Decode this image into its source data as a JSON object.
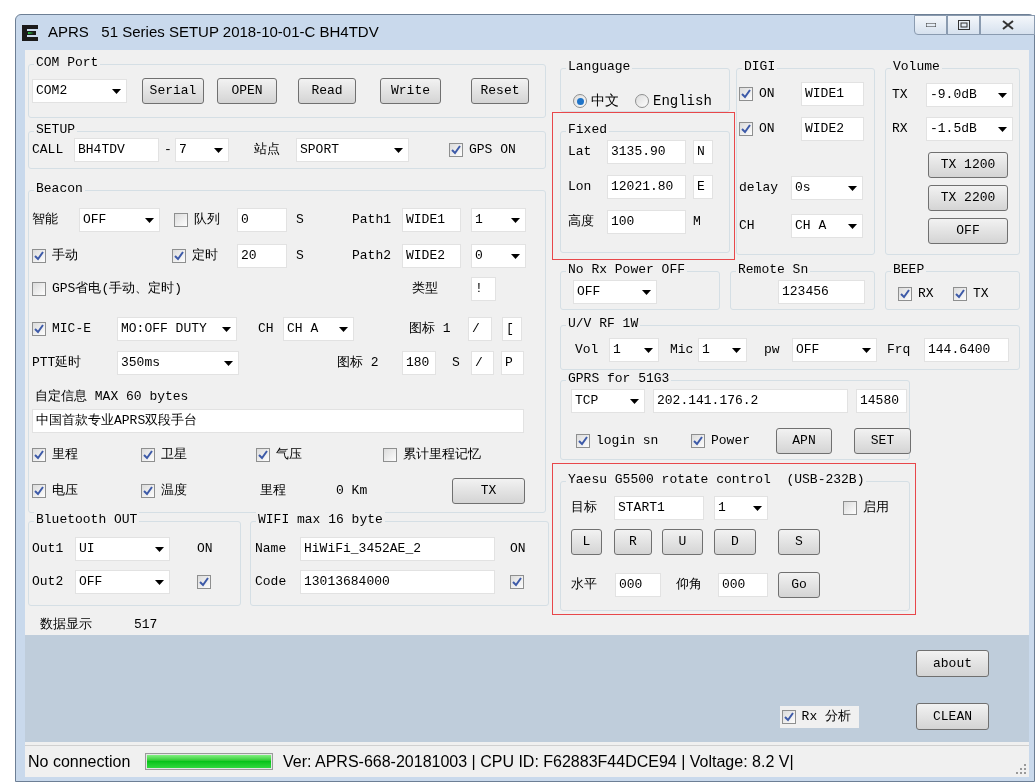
{
  "window": {
    "title": "APRS   51 Series SETUP 2018-10-01-C BH4TDV"
  },
  "left_groups": [
    {
      "title": "COM Port",
      "highlighted": false,
      "rows": [
        {
          "items": [
            {
              "kind": "combo",
              "value": "COM2"
            },
            {
              "kind": "button",
              "label": "Serial"
            },
            {
              "kind": "button",
              "label": "OPEN"
            },
            {
              "kind": "button",
              "label": "Read"
            },
            {
              "kind": "button",
              "label": "Write"
            },
            {
              "kind": "button",
              "label": "Reset"
            }
          ]
        }
      ]
    },
    {
      "title": "SETUP",
      "highlighted": false,
      "rows": [
        {
          "items": [
            {
              "kind": "label",
              "text": "CALL"
            },
            {
              "kind": "text",
              "value": "BH4TDV"
            },
            {
              "kind": "label",
              "text": "-"
            },
            {
              "kind": "combo",
              "value": "7"
            },
            {
              "kind": "label",
              "text": "站点"
            },
            {
              "kind": "combo",
              "value": "SPORT"
            },
            {
              "kind": "check",
              "label": "GPS ON",
              "checked": true
            }
          ]
        }
      ]
    },
    {
      "title": "Beacon",
      "highlighted": false,
      "rows": [
        {
          "items": [
            {
              "kind": "label",
              "text": "智能"
            },
            {
              "kind": "combo",
              "value": "OFF"
            },
            {
              "kind": "check",
              "label": "队列",
              "checked": false
            },
            {
              "kind": "text",
              "value": "0"
            },
            {
              "kind": "label",
              "text": "S"
            },
            {
              "kind": "label",
              "text": "Path1"
            },
            {
              "kind": "text",
              "value": "WIDE1"
            },
            {
              "kind": "combo",
              "value": "1"
            }
          ]
        },
        {
          "items": [
            {
              "kind": "check",
              "label": "手动",
              "checked": true
            },
            {
              "kind": "check",
              "label": "定时",
              "checked": true
            },
            {
              "kind": "text",
              "value": "20"
            },
            {
              "kind": "label",
              "text": "S"
            },
            {
              "kind": "label",
              "text": "Path2"
            },
            {
              "kind": "text",
              "value": "WIDE2"
            },
            {
              "kind": "combo",
              "value": "0"
            }
          ]
        },
        {
          "items": [
            {
              "kind": "check",
              "label": "GPS省电(手动、定时)",
              "checked": false
            },
            {
              "kind": "label",
              "text": "类型"
            },
            {
              "kind": "text",
              "value": "!"
            }
          ]
        },
        {
          "items": [
            {
              "kind": "check",
              "label": "MIC-E",
              "checked": true
            },
            {
              "kind": "combo",
              "value": "MO:OFF DUTY"
            },
            {
              "kind": "label",
              "text": "CH"
            },
            {
              "kind": "combo",
              "value": "CH A"
            },
            {
              "kind": "label",
              "text": "图标 1"
            },
            {
              "kind": "text",
              "value": "/"
            },
            {
              "kind": "text",
              "value": "["
            }
          ]
        },
        {
          "items": [
            {
              "kind": "label",
              "text": "PTT延时"
            },
            {
              "kind": "combo",
              "value": "350ms"
            },
            {
              "kind": "label",
              "text": "图标 2"
            },
            {
              "kind": "text",
              "value": "180"
            },
            {
              "kind": "label",
              "text": "S"
            },
            {
              "kind": "text",
              "value": "/"
            },
            {
              "kind": "text",
              "value": "P"
            }
          ]
        },
        {
          "items": [
            {
              "kind": "label",
              "text": "自定信息 MAX 60 bytes"
            }
          ]
        },
        {
          "items": [
            {
              "kind": "text",
              "value": "中国首款专业APRS双段手台"
            }
          ]
        },
        {
          "items": [
            {
              "kind": "check",
              "label": "里程",
              "checked": true
            },
            {
              "kind": "check",
              "label": "卫星",
              "checked": true
            },
            {
              "kind": "check",
              "label": "气压",
              "checked": true
            },
            {
              "kind": "check",
              "label": "累计里程记忆",
              "checked": false
            }
          ]
        },
        {
          "items": [
            {
              "kind": "check",
              "label": "电压",
              "checked": true
            },
            {
              "kind": "check",
              "label": "温度",
              "checked": true
            },
            {
              "kind": "label",
              "text": "里程"
            },
            {
              "kind": "label",
              "text": "0 Km"
            },
            {
              "kind": "button",
              "label": "TX"
            }
          ]
        }
      ]
    },
    {
      "title": "Bluetooth OUT",
      "highlighted": false,
      "rows": [
        {
          "items": [
            {
              "kind": "label",
              "text": "Out1"
            },
            {
              "kind": "combo",
              "value": "UI"
            },
            {
              "kind": "label",
              "text": "ON"
            }
          ]
        },
        {
          "items": [
            {
              "kind": "label",
              "text": "Out2"
            },
            {
              "kind": "combo",
              "value": "OFF"
            },
            {
              "kind": "check",
              "checked": true
            }
          ]
        }
      ]
    },
    {
      "title": "WIFI max 16 byte",
      "highlighted": false,
      "rows": [
        {
          "items": [
            {
              "kind": "label",
              "text": "Name"
            },
            {
              "kind": "text",
              "value": "HiWiFi_3452AE_2"
            },
            {
              "kind": "label",
              "text": "ON"
            }
          ]
        },
        {
          "items": [
            {
              "kind": "label",
              "text": "Code"
            },
            {
              "kind": "text",
              "value": "13013684000"
            },
            {
              "kind": "check",
              "checked": true
            }
          ]
        }
      ]
    }
  ],
  "data_display": {
    "label": "数据显示",
    "value": "517"
  },
  "right_groups": [
    {
      "title": "Language",
      "highlighted": false,
      "rows": [
        {
          "items": [
            {
              "kind": "radio",
              "label": "中文",
              "selected": true
            },
            {
              "kind": "radio",
              "label": "English",
              "selected": false
            }
          ]
        }
      ]
    },
    {
      "title": "Fixed",
      "highlighted": true,
      "rows": [
        {
          "items": [
            {
              "kind": "label",
              "text": "Lat"
            },
            {
              "kind": "text",
              "value": "3135.90"
            },
            {
              "kind": "text",
              "value": "N"
            }
          ]
        },
        {
          "items": [
            {
              "kind": "label",
              "text": "Lon"
            },
            {
              "kind": "text",
              "value": "12021.80"
            },
            {
              "kind": "text",
              "value": "E"
            }
          ]
        },
        {
          "items": [
            {
              "kind": "label",
              "text": "高度"
            },
            {
              "kind": "text",
              "value": "100"
            },
            {
              "kind": "label",
              "text": "M"
            }
          ]
        }
      ]
    },
    {
      "title": "DIGI",
      "highlighted": false,
      "rows": [
        {
          "items": [
            {
              "kind": "check",
              "label": "ON",
              "checked": true
            },
            {
              "kind": "text",
              "value": "WIDE1"
            }
          ]
        },
        {
          "items": [
            {
              "kind": "check",
              "label": "ON",
              "checked": true
            },
            {
              "kind": "text",
              "value": "WIDE2"
            }
          ]
        },
        {
          "items": [
            {
              "kind": "label",
              "text": "delay"
            },
            {
              "kind": "combo",
              "value": "0s"
            }
          ]
        },
        {
          "items": [
            {
              "kind": "label",
              "text": "CH"
            },
            {
              "kind": "combo",
              "value": "CH A"
            }
          ]
        }
      ]
    },
    {
      "title": "Volume",
      "highlighted": false,
      "rows": [
        {
          "items": [
            {
              "kind": "label",
              "text": "TX"
            },
            {
              "kind": "combo",
              "value": "-9.0dB"
            }
          ]
        },
        {
          "items": [
            {
              "kind": "label",
              "text": "RX"
            },
            {
              "kind": "combo",
              "value": "-1.5dB"
            }
          ]
        },
        {
          "items": [
            {
              "kind": "button",
              "label": "TX 1200"
            }
          ]
        },
        {
          "items": [
            {
              "kind": "button",
              "label": "TX 2200"
            }
          ]
        },
        {
          "items": [
            {
              "kind": "button",
              "label": "OFF"
            }
          ]
        }
      ]
    },
    {
      "title": "No Rx Power OFF",
      "highlighted": false,
      "rows": [
        {
          "items": [
            {
              "kind": "combo",
              "value": "OFF"
            }
          ]
        }
      ]
    },
    {
      "title": "Remote Sn",
      "highlighted": false,
      "rows": [
        {
          "items": [
            {
              "kind": "text",
              "value": "123456"
            }
          ]
        }
      ]
    },
    {
      "title": "BEEP",
      "highlighted": false,
      "rows": [
        {
          "items": [
            {
              "kind": "check",
              "label": "RX",
              "checked": true
            },
            {
              "kind": "check",
              "label": "TX",
              "checked": true
            }
          ]
        }
      ]
    },
    {
      "title": "U/V RF 1W",
      "highlighted": false,
      "rows": [
        {
          "items": [
            {
              "kind": "label",
              "text": "Vol"
            },
            {
              "kind": "combo",
              "value": "1"
            },
            {
              "kind": "label",
              "text": "Mic"
            },
            {
              "kind": "combo",
              "value": "1"
            },
            {
              "kind": "label",
              "text": "pw"
            },
            {
              "kind": "combo",
              "value": "OFF"
            },
            {
              "kind": "label",
              "text": "Frq"
            },
            {
              "kind": "text",
              "value": "144.6400"
            }
          ]
        }
      ]
    },
    {
      "title": "GPRS for 51G3",
      "highlighted": false,
      "rows": [
        {
          "items": [
            {
              "kind": "combo",
              "value": "TCP"
            },
            {
              "kind": "text",
              "value": "202.141.176.2"
            },
            {
              "kind": "text",
              "value": "14580"
            }
          ]
        },
        {
          "items": [
            {
              "kind": "check",
              "label": "login sn",
              "checked": true
            },
            {
              "kind": "check",
              "label": "Power",
              "checked": true
            },
            {
              "kind": "button",
              "label": "APN"
            },
            {
              "kind": "button",
              "label": "SET"
            }
          ]
        }
      ]
    },
    {
      "title": "Yaesu G5500 rotate control  (USB-232B)",
      "highlighted": true,
      "rows": [
        {
          "items": [
            {
              "kind": "label",
              "text": "目标"
            },
            {
              "kind": "text",
              "value": "START1"
            },
            {
              "kind": "combo",
              "value": "1"
            },
            {
              "kind": "check",
              "label": "启用",
              "checked": false
            }
          ]
        },
        {
          "items": [
            {
              "kind": "button",
              "label": "L"
            },
            {
              "kind": "button",
              "label": "R"
            },
            {
              "kind": "button",
              "label": "U"
            },
            {
              "kind": "button",
              "label": "D"
            },
            {
              "kind": "button",
              "label": "S"
            }
          ]
        },
        {
          "items": [
            {
              "kind": "label",
              "text": "水平"
            },
            {
              "kind": "text",
              "value": "000"
            },
            {
              "kind": "label",
              "text": "仰角"
            },
            {
              "kind": "text",
              "value": "000"
            },
            {
              "kind": "button",
              "label": "Go"
            }
          ]
        }
      ]
    }
  ],
  "log_panel": {
    "about": "about",
    "rx_check": {
      "label": "Rx 分析",
      "checked": true
    },
    "clean": "CLEAN"
  },
  "status_bar": {
    "connection": "No connection",
    "level": 1,
    "info": "Ver: APRS-668-20181003 | CPU ID: F62883F44DCE94 | Voltage: 8.2 V|"
  }
}
